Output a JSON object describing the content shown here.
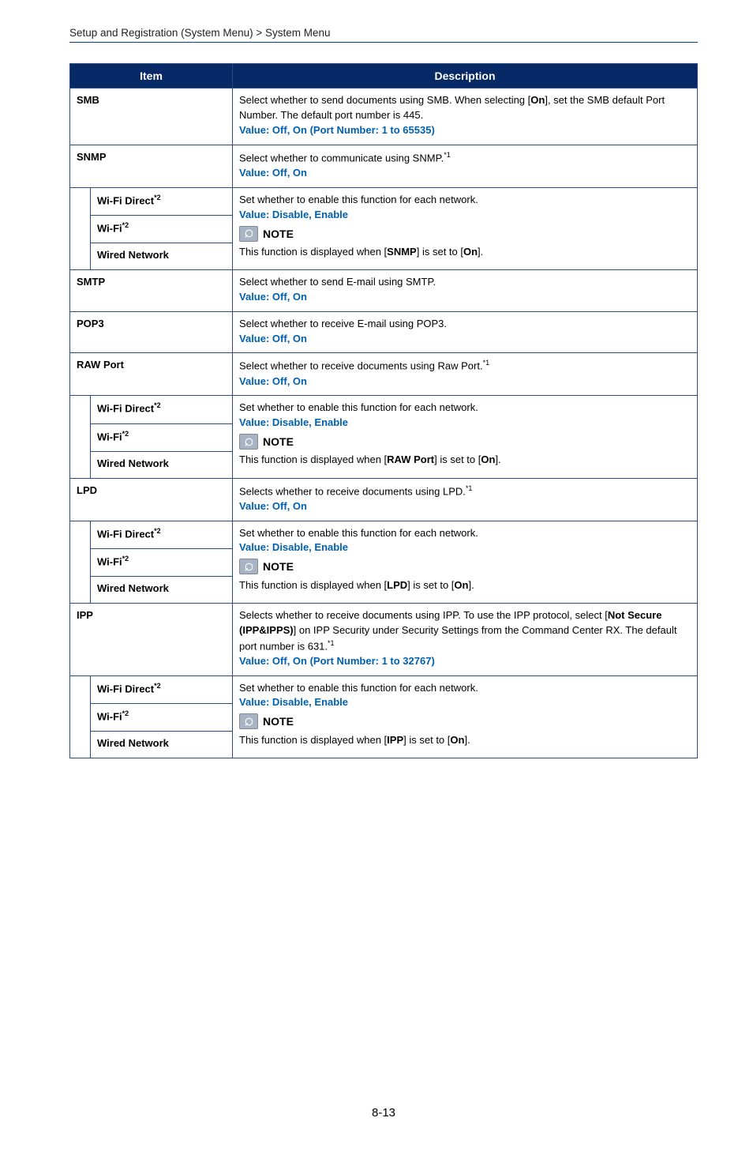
{
  "breadcrumb": "Setup and Registration (System Menu) > System Menu",
  "page_number": "8-13",
  "header_item": "Item",
  "header_desc": "Description",
  "label_value": "Value",
  "label_note": "NOTE",
  "sub": {
    "wifidirect": "Wi-Fi Direct",
    "wifi": "Wi-Fi",
    "wired": "Wired Network",
    "sup2": "*2",
    "sub_desc": "Set whether to enable this function for each network.",
    "sub_value": ": Disable, Enable"
  },
  "rows": {
    "smb": {
      "item": "SMB",
      "desc": "Select whether to send documents using SMB. When selecting [",
      "on": "On",
      "desc2": "], set the SMB default Port Number. The default port number is 445.",
      "value": ": Off, On (Port Number: 1 to 65535)"
    },
    "snmp": {
      "item": "SNMP",
      "desc": "Select whether to communicate using SNMP.",
      "sup": "*1",
      "value": ": Off, On",
      "note": "This function is displayed when [",
      "noteb1": "SNMP",
      "note_mid": "] is set to [",
      "noteb2": "On",
      "note_end": "]."
    },
    "smtp": {
      "item": "SMTP",
      "desc": "Select whether to send E-mail using SMTP.",
      "value": ": Off, On"
    },
    "pop3": {
      "item": "POP3",
      "desc": "Select whether to receive E-mail using POP3.",
      "value": ": Off, On"
    },
    "raw": {
      "item": "RAW Port",
      "desc": "Select whether to receive documents using Raw Port.",
      "sup": "*1",
      "value": ": Off, On",
      "note": "This function is displayed when [",
      "noteb1": "RAW Port",
      "note_mid": "] is set to [",
      "noteb2": "On",
      "note_end": "]."
    },
    "lpd": {
      "item": "LPD",
      "desc": "Selects whether to receive documents using LPD.",
      "sup": "*1",
      "value": ": Off, On",
      "note": "This function is displayed when [",
      "noteb1": "LPD",
      "note_mid": "] is set to [",
      "noteb2": "On",
      "note_end": "]."
    },
    "ipp": {
      "item": "IPP",
      "desc1": "Selects whether to receive documents using IPP. To use the IPP protocol, select [",
      "b1": "Not Secure (IPP&IPPS)",
      "desc2": "] on IPP Security under Security Settings from the Command Center RX. The default port number is 631.",
      "sup": "*1",
      "value": ": Off, On (Port Number: 1 to 32767)",
      "note": "This function is displayed when [",
      "noteb1": "IPP",
      "note_mid": "] is set to [",
      "noteb2": "On",
      "note_end": "]."
    }
  }
}
